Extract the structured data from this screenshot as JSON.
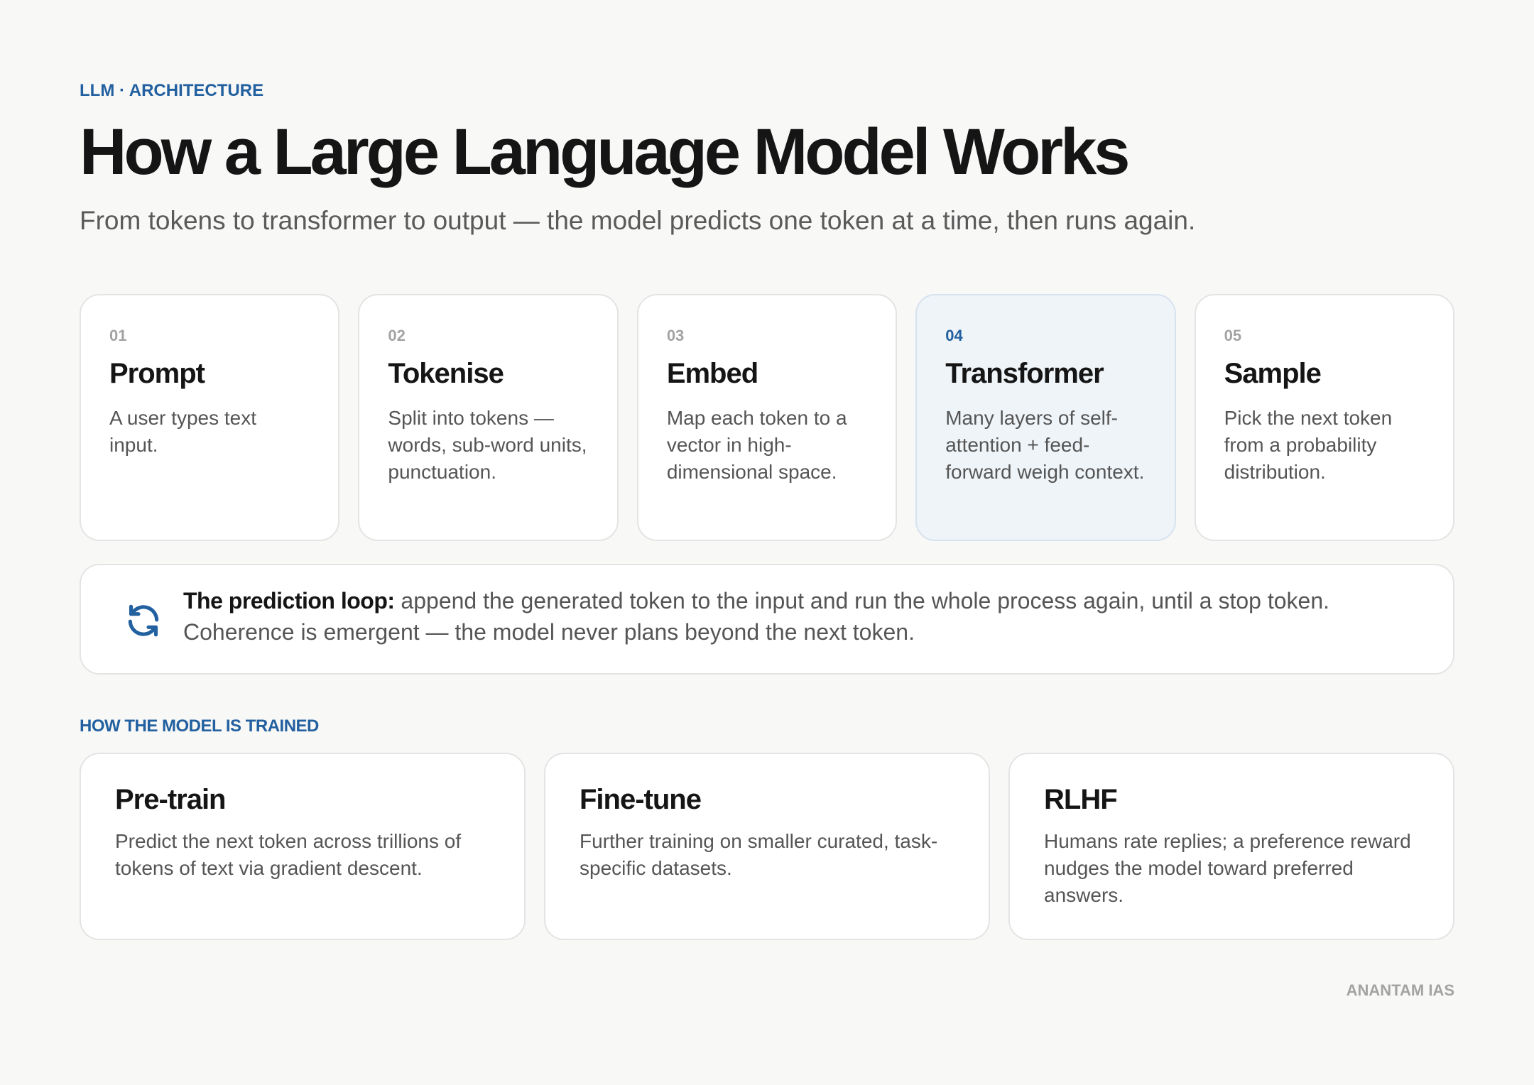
{
  "header": {
    "eyebrow": "LLM · ARCHITECTURE",
    "title": "How a Large Language Model Works",
    "subtitle": "From tokens to transformer to output — the model predicts one token at a time, then runs again."
  },
  "steps": [
    {
      "num": "01",
      "title": "Prompt",
      "desc": "A user types text input."
    },
    {
      "num": "02",
      "title": "Tokenise",
      "desc": "Split into tokens — words, sub-word units, punctuation."
    },
    {
      "num": "03",
      "title": "Embed",
      "desc": "Map each token to a vector in high-dimensional space."
    },
    {
      "num": "04",
      "title": "Transformer",
      "desc": "Many layers of self-attention + feed-forward weigh context."
    },
    {
      "num": "05",
      "title": "Sample",
      "desc": "Pick the next token from a probability distribution."
    }
  ],
  "loop": {
    "icon": "refresh-icon",
    "lead": "The prediction loop:",
    "text": " append the generated token to the input and run the whole process again, until a stop token. Coherence is emergent — the model never plans beyond the next token."
  },
  "training": {
    "label": "HOW THE MODEL IS TRAINED",
    "cards": [
      {
        "title": "Pre-train",
        "desc": "Predict the next token across trillions of tokens of text via gradient descent."
      },
      {
        "title": "Fine-tune",
        "desc": "Further training on smaller curated, task-specific datasets."
      },
      {
        "title": "RLHF",
        "desc": "Humans rate replies; a preference reward nudges the model toward preferred answers."
      }
    ]
  },
  "footer": {
    "brand": "ANANTAM IAS"
  },
  "colors": {
    "accent": "#22609f",
    "background": "#f8f8f7",
    "highlight_card": "#eff4f8"
  }
}
